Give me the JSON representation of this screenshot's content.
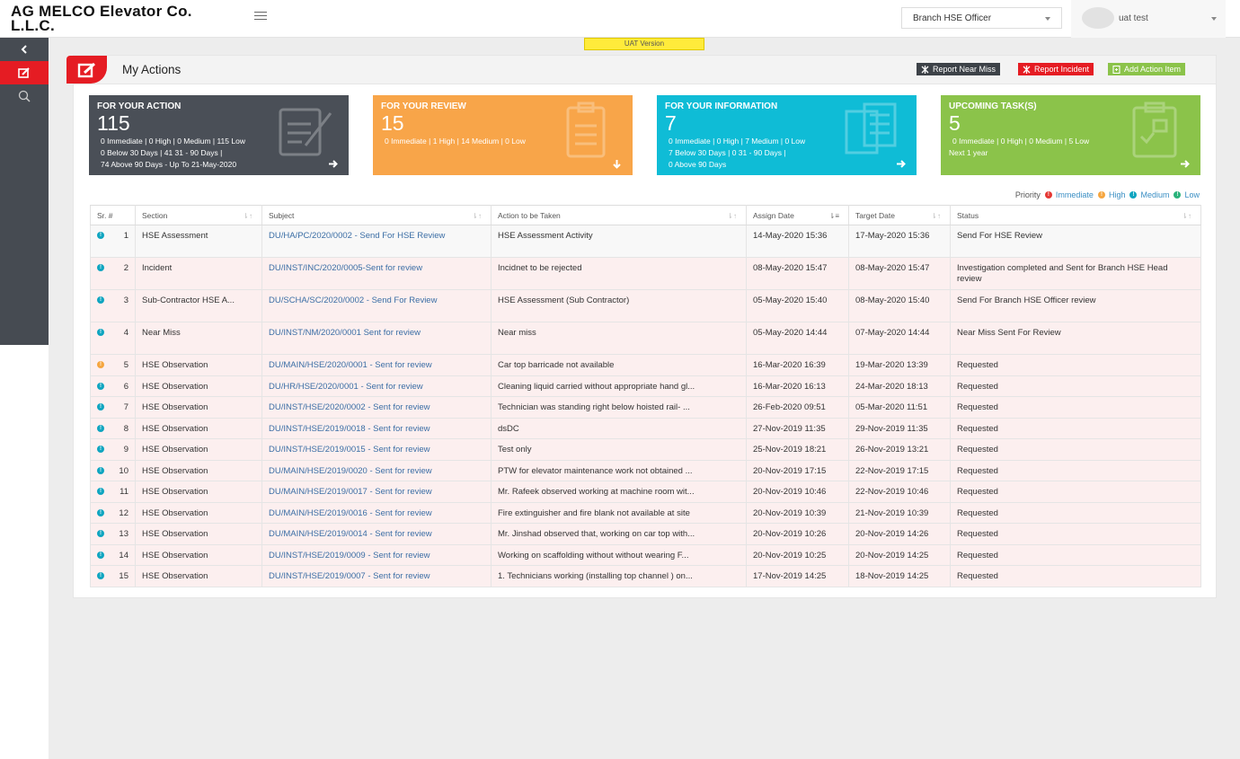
{
  "app": {
    "title": "AG MELCO Elevator Co. L.L.C.",
    "role": "Branch HSE Officer",
    "user": "uat test",
    "env_badge": "UAT Version"
  },
  "page": {
    "title": "My Actions",
    "buttons": {
      "near_miss": "Report Near Miss",
      "incident": "Report Incident",
      "add_action": "Add Action Item"
    }
  },
  "cards": [
    {
      "title": "FOR YOUR ACTION",
      "count": "115",
      "line1": "0 Immediate | 0 High | 0 Medium | 115 Low",
      "line2": "0 Below 30 Days | 41 31 - 90 Days |",
      "line3": "74 Above 90 Days  - Up To 21-May-2020",
      "color": "#4a4f57"
    },
    {
      "title": "FOR YOUR REVIEW",
      "count": "15",
      "line1": "0 Immediate | 1 High | 14 Medium | 0 Low",
      "line2": "",
      "line3": "",
      "color": "#f8a549"
    },
    {
      "title": "FOR YOUR INFORMATION",
      "count": "7",
      "line1": "0 Immediate | 0 High | 7 Medium | 0 Low",
      "line2": "7 Below 30 Days | 0 31 - 90 Days |",
      "line3": "0 Above 90 Days",
      "color": "#0fbcd6"
    },
    {
      "title": "UPCOMING TASK(S)",
      "count": "5",
      "line1": "0 Immediate | 0 High | 0 Medium | 5 Low",
      "line2": "Next 1 year",
      "line3": "",
      "color": "#8bc34a"
    }
  ],
  "legend": {
    "label": "Priority",
    "items": [
      {
        "name": "Immediate",
        "color": "#e53935"
      },
      {
        "name": "High",
        "color": "#f5a640"
      },
      {
        "name": "Medium",
        "color": "#0fa5c0"
      },
      {
        "name": "Low",
        "color": "#2ab27b"
      }
    ]
  },
  "table": {
    "headers": [
      "Sr. #",
      "Section",
      "Subject",
      "Action to be Taken",
      "Assign Date",
      "Target Date",
      "Status"
    ],
    "rows": [
      {
        "sr": "1",
        "priority": "Medium",
        "section": "HSE Assessment",
        "subject": "DU/HA/PC/2020/0002 - Send For HSE Review",
        "action": "HSE Assessment Activity",
        "assign": "14-May-2020 15:36",
        "target": "17-May-2020 15:36",
        "status": "Send For HSE Review"
      },
      {
        "sr": "2",
        "priority": "Medium",
        "section": "Incident",
        "subject": "DU/INST/INC/2020/0005-Sent for review",
        "action": "Incidnet to be rejected",
        "assign": "08-May-2020 15:47",
        "target": "08-May-2020 15:47",
        "status": "Investigation completed and Sent for Branch HSE Head review"
      },
      {
        "sr": "3",
        "priority": "Medium",
        "section": "Sub-Contractor HSE A...",
        "subject": "DU/SCHA/SC/2020/0002 - Send For Review",
        "action": "HSE Assessment (Sub Contractor)",
        "assign": "05-May-2020 15:40",
        "target": "08-May-2020 15:40",
        "status": "Send For Branch HSE Officer review"
      },
      {
        "sr": "4",
        "priority": "Medium",
        "section": "Near Miss",
        "subject": "DU/INST/NM/2020/0001 Sent for review",
        "action": "Near miss",
        "assign": "05-May-2020 14:44",
        "target": "07-May-2020 14:44",
        "status": "Near Miss Sent For Review"
      },
      {
        "sr": "5",
        "priority": "High",
        "section": "HSE Observation",
        "subject": "DU/MAIN/HSE/2020/0001 - Sent for review",
        "action": "Car top barricade not available",
        "assign": "16-Mar-2020 16:39",
        "target": "19-Mar-2020 13:39",
        "status": "Requested"
      },
      {
        "sr": "6",
        "priority": "Medium",
        "section": "HSE Observation",
        "subject": "DU/HR/HSE/2020/0001 - Sent for review",
        "action": "Cleaning liquid carried without appropriate hand gl...",
        "assign": "16-Mar-2020 16:13",
        "target": "24-Mar-2020 18:13",
        "status": "Requested"
      },
      {
        "sr": "7",
        "priority": "Medium",
        "section": "HSE Observation",
        "subject": "DU/INST/HSE/2020/0002 - Sent for review",
        "action": "Technician was standing right below hoisted rail- ...",
        "assign": "26-Feb-2020 09:51",
        "target": "05-Mar-2020 11:51",
        "status": "Requested"
      },
      {
        "sr": "8",
        "priority": "Medium",
        "section": "HSE Observation",
        "subject": "DU/INST/HSE/2019/0018 - Sent for review",
        "action": "dsDC",
        "assign": "27-Nov-2019 11:35",
        "target": "29-Nov-2019 11:35",
        "status": "Requested"
      },
      {
        "sr": "9",
        "priority": "Medium",
        "section": "HSE Observation",
        "subject": "DU/INST/HSE/2019/0015 - Sent for review",
        "action": "Test only",
        "assign": "25-Nov-2019 18:21",
        "target": "26-Nov-2019 13:21",
        "status": "Requested"
      },
      {
        "sr": "10",
        "priority": "Medium",
        "section": "HSE Observation",
        "subject": "DU/MAIN/HSE/2019/0020 - Sent for review",
        "action": "PTW for elevator maintenance work not obtained ...",
        "assign": "20-Nov-2019 17:15",
        "target": "22-Nov-2019 17:15",
        "status": "Requested"
      },
      {
        "sr": "11",
        "priority": "Medium",
        "section": "HSE Observation",
        "subject": "DU/MAIN/HSE/2019/0017 - Sent for review",
        "action": "Mr. Rafeek observed working at machine room wit...",
        "assign": "20-Nov-2019 10:46",
        "target": "22-Nov-2019 10:46",
        "status": "Requested"
      },
      {
        "sr": "12",
        "priority": "Medium",
        "section": "HSE Observation",
        "subject": "DU/MAIN/HSE/2019/0016 - Sent for review",
        "action": "Fire extinguisher and fire blank not available at site",
        "assign": "20-Nov-2019 10:39",
        "target": "21-Nov-2019 10:39",
        "status": "Requested"
      },
      {
        "sr": "13",
        "priority": "Medium",
        "section": "HSE Observation",
        "subject": "DU/MAIN/HSE/2019/0014 - Sent for review",
        "action": "Mr. Jinshad observed that, working on car top with...",
        "assign": "20-Nov-2019 10:26",
        "target": "20-Nov-2019 14:26",
        "status": "Requested"
      },
      {
        "sr": "14",
        "priority": "Medium",
        "section": "HSE Observation",
        "subject": "DU/INST/HSE/2019/0009 - Sent for review",
        "action": "Working on scaffolding without without wearing F...",
        "assign": "20-Nov-2019 10:25",
        "target": "20-Nov-2019 14:25",
        "status": "Requested"
      },
      {
        "sr": "15",
        "priority": "Medium",
        "section": "HSE Observation",
        "subject": "DU/INST/HSE/2019/0007 - Sent for review",
        "action": "1. Technicians working (installing top channel ) on...",
        "assign": "17-Nov-2019 14:25",
        "target": "18-Nov-2019 14:25",
        "status": "Requested"
      }
    ]
  }
}
